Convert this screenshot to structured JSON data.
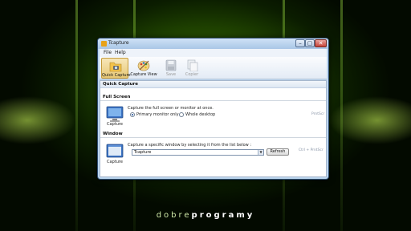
{
  "window": {
    "title": "Tcapture"
  },
  "menu": [
    "File",
    "Help"
  ],
  "toolbar": {
    "quick_capture": "Quick Capture",
    "capture_view": "Capture View",
    "save": "Save",
    "copier": "Copier"
  },
  "quick_capture_header": "Quick Capture",
  "full_screen": {
    "header": "Full Screen",
    "icon_label": "Capture",
    "description": "Capture the full screen or monitor at once.",
    "options": [
      "Primary monitor only",
      "Whole desktop"
    ],
    "selected_option": "Primary monitor only",
    "hotkey": "PrntScr"
  },
  "window_section": {
    "header": "Window",
    "icon_label": "Capture",
    "description": "Capture a specific window by selecting it from the list below :",
    "selected_window": "Tcapture",
    "refresh_label": "Refresh",
    "hotkey": "Ctrl + PrntScr"
  },
  "brand": {
    "part1": "dobre",
    "part2": "programy"
  },
  "colors": {
    "accent": "#e8c876",
    "wallpaper_glow": "#b6ff4d",
    "window_frame": "#bcd6ef"
  }
}
